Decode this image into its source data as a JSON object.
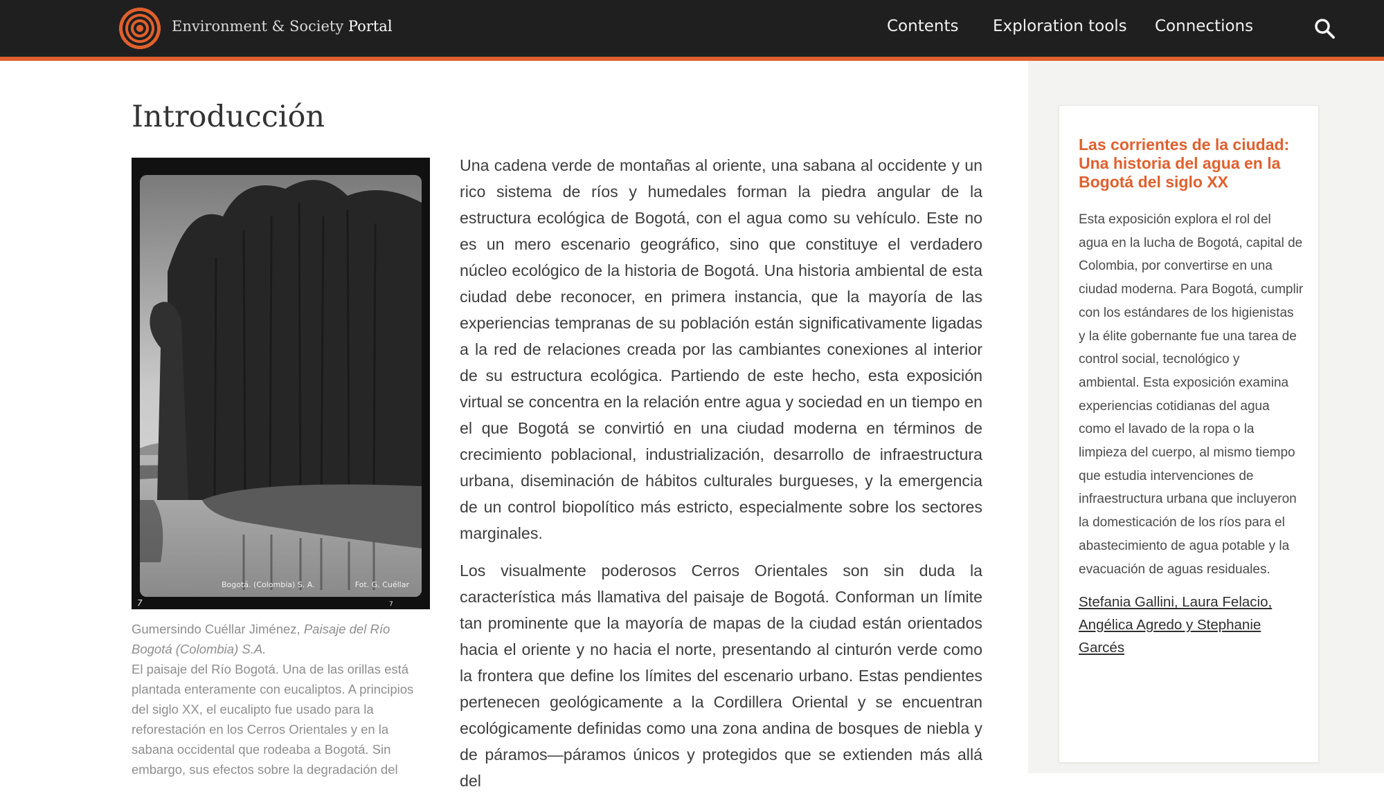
{
  "header": {
    "brand_regular": "Environment & Society ",
    "brand_strong": "Portal",
    "nav": {
      "contents": "Contents",
      "exploration_tools": "Exploration tools",
      "connections": "Connections"
    },
    "icons": {
      "logo": "concentric-rings-logo",
      "search": "search-icon"
    },
    "colors": {
      "bar": "#1f1f1f",
      "accent": "#e0602d"
    }
  },
  "main": {
    "title": "Introducción",
    "photo": {
      "strip_location": "Bogotá. (Colombia) S. A.",
      "strip_credit": "Fot. G. Cuéllar",
      "frame_left": "7",
      "frame_right": "7"
    },
    "caption": {
      "author": "Gumersindo Cuéllar Jiménez, ",
      "artwork": "Paisaje del Río Bogotá (Colombia) S.A.",
      "text": "El paisaje del Río Bogotá. Una de las orillas está plantada enteramente con eucaliptos. A principios del siglo XX, el eucalipto fue usado para la reforestación en los Cerros Orientales y en la sabana occidental que rodeaba a Bogotá. Sin embargo, sus efectos sobre la degradación del"
    },
    "paragraphs": [
      "Una cadena verde de montañas al oriente, una sabana al occidente y un rico sistema de ríos y humedales forman la piedra angular de la estructura ecológica de Bogotá, con el agua como su vehículo. Este no es un mero escenario geográfico, sino que constituye el verdadero núcleo ecológico de la historia de Bogotá. Una historia ambiental de esta ciudad debe reconocer, en primera instancia, que la mayoría de las experiencias tempranas de su población están significativamente ligadas a la red de relaciones creada por las cambiantes conexiones al interior de su estructura ecológica. Partiendo de este hecho, esta exposición virtual se concentra en la relación entre agua y sociedad en un tiempo en el que Bogotá se convirtió en una ciudad moderna en términos de crecimiento poblacional, industrialización, desarrollo de infraestructura urbana, diseminación de hábitos culturales burgueses, y la emergencia de un control biopolítico más estricto, especialmente sobre los sectores marginales.",
      "Los visualmente poderosos Cerros Orientales son sin duda la característica más llamativa del paisaje de Bogotá. Conforman un límite tan prominente que la mayoría de mapas de la ciudad están orientados hacia el oriente y no hacia el norte, presentando al cinturón verde como la frontera que define los límites del escenario urbano. Estas pendientes pertenecen geológicamente a la Cordillera Oriental y se encuentran ecológicamente definidas como una zona andina de bosques de niebla y de páramos—páramos únicos y protegidos que se extienden más allá del"
    ]
  },
  "sidebar": {
    "title": "Las corrientes de la ciudad: Una historia del agua en la Bogotá del siglo XX",
    "description": "Esta exposición explora el rol del agua en la lucha de Bogotá, capital de Colombia, por convertirse en una ciudad moderna. Para Bogotá, cumplir con los estándares de los higienistas y la élite gobernante fue una tarea de control social, tecnológico y ambiental. Esta exposición examina experiencias cotidianas del agua como el lavado de la ropa o la limpieza del cuerpo, al mismo tiempo que estudia intervenciones de infraestructura urbana que incluyeron la domesticación de los ríos para el abastecimiento de agua potable y la evacuación de aguas residuales.",
    "authors": "Stefania Gallini, Laura Felacio, Angélica Agredo y Stephanie Garcés"
  }
}
